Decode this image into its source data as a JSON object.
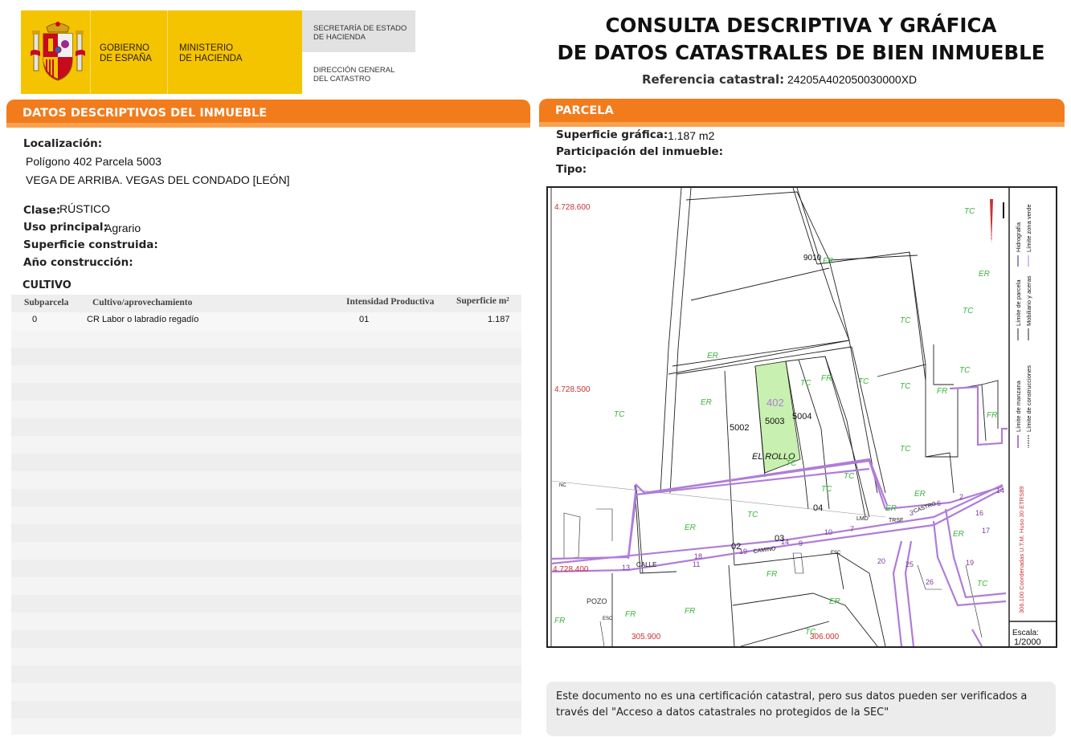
{
  "header": {
    "gov_line1": "GOBIERNO",
    "gov_line2": "DE ESPAÑA",
    "min_line1": "MINISTERIO",
    "min_line2": "DE HACIENDA",
    "sec_line1": "SECRETARÍA DE ESTADO",
    "sec_line2": "DE HACIENDA",
    "dir_line1": "DIRECCIÓN GENERAL",
    "dir_line2": "DEL CATASTRO",
    "title_line1": "CONSULTA DESCRIPTIVA Y GRÁFICA",
    "title_line2": "DE DATOS CATASTRALES DE BIEN INMUEBLE",
    "ref_label": "Referencia catastral:",
    "ref_value": "24205A402050030000XD"
  },
  "left": {
    "section_title": "DATOS DESCRIPTIVOS DEL INMUEBLE",
    "localizacion_label": "Localización:",
    "localizacion_line1": "Polígono 402 Parcela 5003",
    "localizacion_line2": "VEGA DE ARRIBA. VEGAS DEL CONDADO [LEÓN]",
    "clase_label": "Clase:",
    "clase_value": "RÚSTICO",
    "uso_label": "Uso principal:",
    "uso_value": "Agrario",
    "sup_construida_label": "Superficie construida:",
    "anio_label": "Año construcción:",
    "cultivo_title": "CULTIVO",
    "table_headers": [
      "Subparcela",
      "Cultivo/aprovechamiento",
      "Intensidad Productiva",
      "Superficie m²"
    ],
    "table_rows": [
      [
        "0",
        "CR Labor o labradío regadío",
        "01",
        "1.187"
      ]
    ]
  },
  "right": {
    "section_title": "PARCELA",
    "superficie_label": "Superficie gráfica:",
    "superficie_value": "1.187 m2",
    "participacion_label": "Participación del inmueble:",
    "tipo_label": "Tipo:",
    "map": {
      "coords": {
        "n1": "4.728.600",
        "n2": "4.728.500",
        "n3": "4.728.400",
        "e1": "305.900",
        "e2": "306.000"
      },
      "labels": {
        "poligono": "402",
        "parcela": "5003",
        "p5002": "5002",
        "p5004": "5004",
        "p9010": "9010",
        "paraje": "EL ROLLO",
        "calle": "CALLE",
        "camino": "CAMINO",
        "castro": "CASTRO",
        "pozo": "POZO"
      },
      "legend": {
        "limite_manzana": "Límite de manzana",
        "limite_parcela": "Límite de parcela",
        "limite_construcciones": "Límite de construcciones",
        "mobiliario": "Mobiliario y aceras",
        "hidrografia": "Hidrografía",
        "zona_verde": "Límite zona verde",
        "coordenadas": "306.100 Coordenadas U.T.M. Huso 30 ETRS89",
        "escala_label": "Escala:",
        "escala_value": "1/2000"
      }
    },
    "notice": "Este documento no es una certificación catastral, pero sus datos pueden ser verificados a través del \"Acceso a datos catastrales no protegidos de la SEC\""
  },
  "colors": {
    "orange": "#f27b1c",
    "gold": "#f5c400",
    "parcel_fill": "#c8f0b0",
    "manzana": "#b07cd8",
    "coord_red": "#c83232",
    "land_use_green": "#3cb43c"
  }
}
